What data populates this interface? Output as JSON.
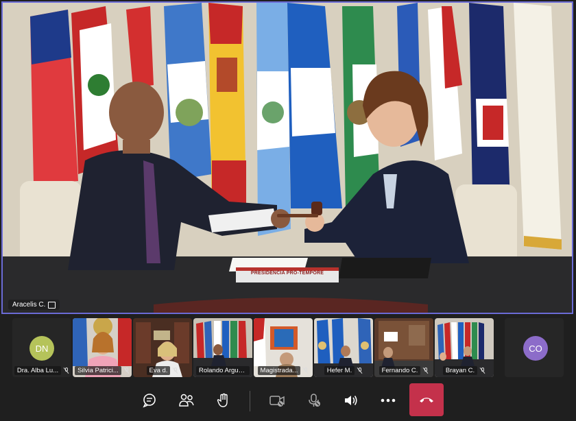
{
  "main_video": {
    "speaker": "Aracelis C.",
    "nameplate": "PRESIDENCIA PRO-TEMPORE"
  },
  "participants": [
    {
      "name": "Dra. Alba Lu...",
      "type": "avatar",
      "initials": "DN",
      "color": "#b5c35a"
    },
    {
      "name": "Silvia Patrici...",
      "type": "video"
    },
    {
      "name": "Eva d.",
      "type": "video"
    },
    {
      "name": "Rolando Argue...",
      "type": "video"
    },
    {
      "name": "Magistrada...",
      "type": "video"
    },
    {
      "name": "Hefer M.",
      "type": "video"
    },
    {
      "name": "Fernando C.",
      "type": "video"
    },
    {
      "name": "Brayan C.",
      "type": "video"
    },
    {
      "name": "",
      "type": "avatar",
      "initials": "CO",
      "color": "#8c6cc9"
    }
  ],
  "toolbar": {
    "chat_icon": "chat-icon",
    "people_icon": "people-icon",
    "raise_hand_icon": "raise-hand-icon",
    "camera_icon": "camera-off-icon",
    "mic_icon": "mic-off-icon",
    "speaker_icon": "speaker-icon",
    "more_icon": "more-icon",
    "hangup_icon": "hangup-icon",
    "hangup_color": "#c4314b"
  }
}
